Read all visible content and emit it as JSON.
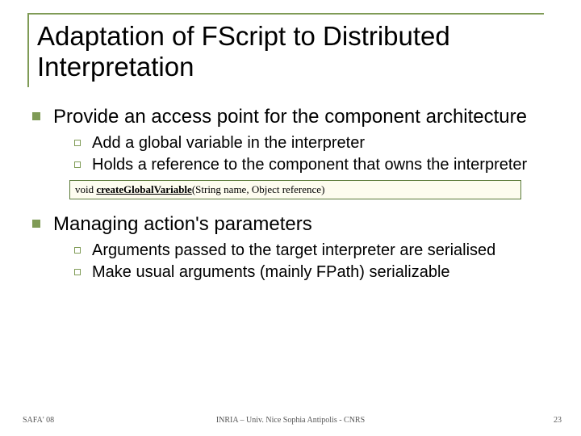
{
  "title": "Adaptation of FScript to Distributed Interpretation",
  "points": [
    {
      "text": "Provide an access point for the component architecture",
      "sub": [
        "Add a global variable in the interpreter",
        "Holds a reference to the component that owns the interpreter"
      ]
    },
    {
      "text": "Managing action's parameters",
      "sub": [
        "Arguments passed to the target interpreter are serialised",
        "Make usual arguments (mainly FPath) serializable"
      ]
    }
  ],
  "code": {
    "prefix": "void ",
    "method": "createGlobalVariable",
    "suffix": "(String name, Object reference)"
  },
  "footer": {
    "left": "SAFA' 08",
    "center": "INRIA – Univ. Nice Sophia Antipolis - CNRS",
    "right": "23"
  }
}
